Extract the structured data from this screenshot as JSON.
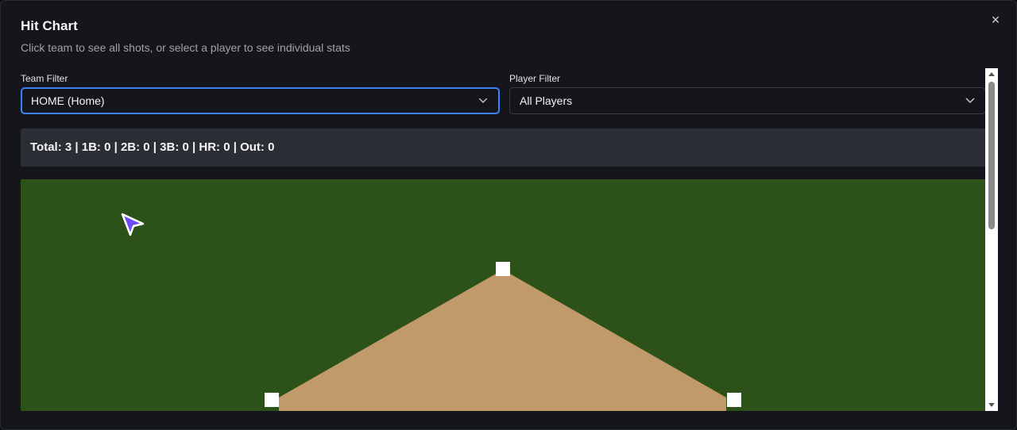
{
  "dialog": {
    "title": "Hit Chart",
    "subtitle": "Click team to see all shots, or select a player to see individual stats",
    "close_icon": "×"
  },
  "filters": {
    "team": {
      "label": "Team Filter",
      "value": "HOME (Home)"
    },
    "player": {
      "label": "Player Filter",
      "value": "All Players"
    }
  },
  "stats": {
    "text": "Total: 3 | 1B: 0 | 2B: 0 | 3B: 0 | HR: 0 | Out: 0"
  },
  "colors": {
    "grass": "#2d5219",
    "infield_dirt": "#c19a6b",
    "base": "#ffffff",
    "focus_accent": "#3b82f6",
    "cursor": "#6d4cf5"
  },
  "icons": {
    "close": "close-icon",
    "team_dropdown": "chevron-down-icon",
    "player_dropdown": "chevron-down-icon",
    "cursor": "cursor-arrow-icon"
  }
}
